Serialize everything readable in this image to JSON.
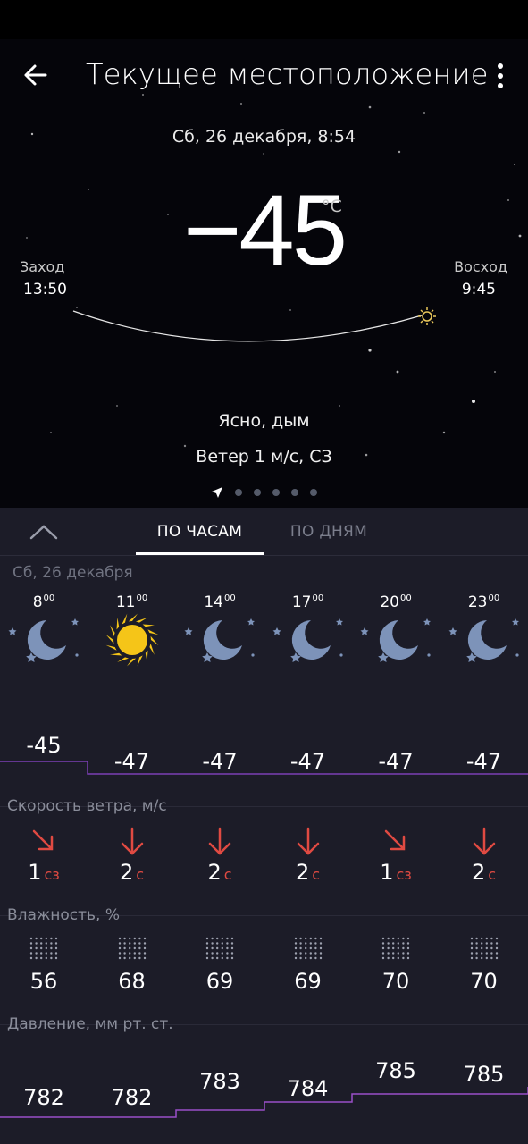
{
  "header": {
    "title": "Текущее местоположение",
    "back_icon": "arrow-left-icon",
    "menu_icon": "more-vertical-icon"
  },
  "current": {
    "datetime": "Сб, 26 декабря, 8:54",
    "temperature": "−45",
    "unit": "°C",
    "sunset_label": "Заход",
    "sunset_time": "13:50",
    "sunrise_label": "Восход",
    "sunrise_time": "9:45",
    "condition": "Ясно, дым",
    "wind": "Ветер 1 м/с, СЗ"
  },
  "pager": {
    "location_icon": "navigation-arrow-icon",
    "dots": 5
  },
  "tabs": {
    "hourly": "ПО ЧАСАМ",
    "daily": "ПО ДНЯМ"
  },
  "day_label": "Сб, 26 декабря",
  "hours": [
    {
      "hour": "8",
      "min": "00",
      "icon": "moon-icon",
      "temp": "-45",
      "wind_speed": "1",
      "wind_dir": "сз",
      "humidity": "56",
      "pressure": "782"
    },
    {
      "hour": "11",
      "min": "00",
      "icon": "sun-icon",
      "temp": "-47",
      "wind_speed": "2",
      "wind_dir": "с",
      "humidity": "68",
      "pressure": "782"
    },
    {
      "hour": "14",
      "min": "00",
      "icon": "moon-icon",
      "temp": "-47",
      "wind_speed": "2",
      "wind_dir": "с",
      "humidity": "69",
      "pressure": "783"
    },
    {
      "hour": "17",
      "min": "00",
      "icon": "moon-icon",
      "temp": "-47",
      "wind_speed": "2",
      "wind_dir": "с",
      "humidity": "69",
      "pressure": "784"
    },
    {
      "hour": "20",
      "min": "00",
      "icon": "moon-icon",
      "temp": "-47",
      "wind_speed": "1",
      "wind_dir": "сз",
      "humidity": "70",
      "pressure": "785"
    },
    {
      "hour": "23",
      "min": "00",
      "icon": "moon-icon",
      "temp": "-47",
      "wind_speed": "2",
      "wind_dir": "с",
      "humidity": "70",
      "pressure": "785"
    }
  ],
  "sections": {
    "wind": "Скорость ветра, м/с",
    "humidity": "Влажность, %",
    "pressure": "Давление, мм рт. ст."
  },
  "colors": {
    "panel": "#1c1c28",
    "chart_line": "#7b3fb4",
    "wind_arrow": "#e04a42",
    "moon": "#7d93b9",
    "sun": "#f5c518"
  }
}
